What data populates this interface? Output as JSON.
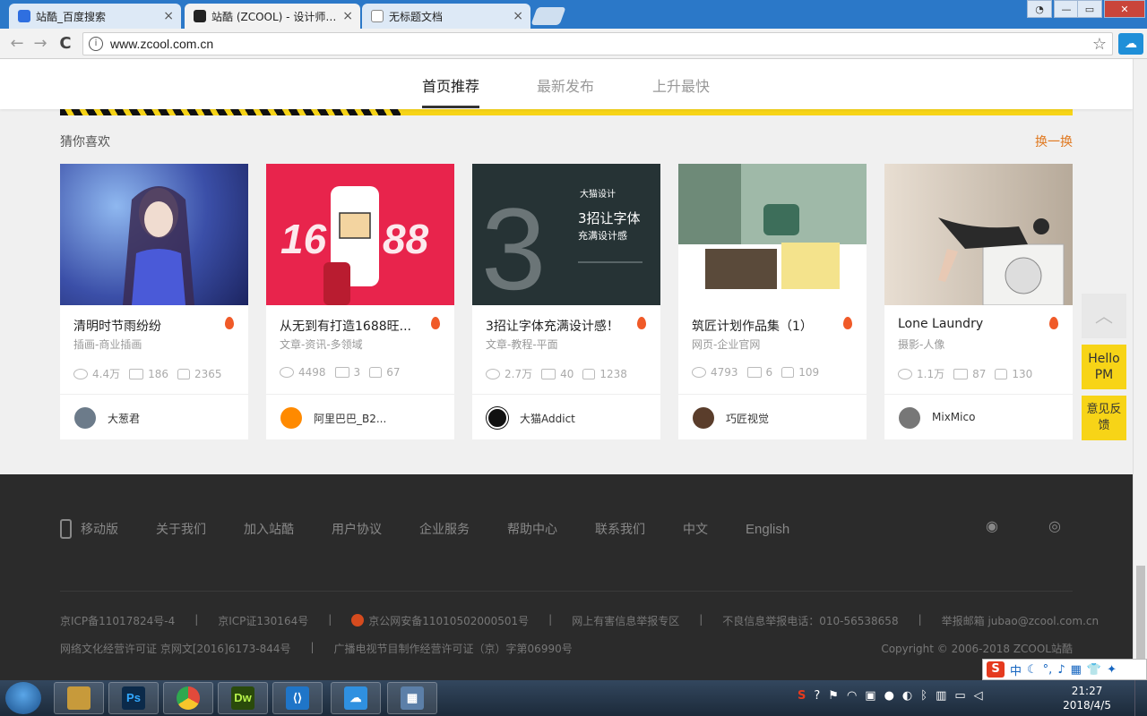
{
  "browser": {
    "tabs": [
      {
        "label": "站酷_百度搜索",
        "active": false,
        "favicon_color": "#2f6fe0"
      },
      {
        "label": "站酷 (ZCOOL) - 设计师互动平台",
        "active": true,
        "favicon_color": "#222222"
      },
      {
        "label": "无标题文档",
        "active": false,
        "favicon_color": "#888888"
      }
    ],
    "url": "www.zcool.com.cn",
    "close_label": "×",
    "back_icon": "←",
    "forward_icon": "→",
    "reload_icon": "C",
    "star_icon": "☆",
    "info_icon": "i"
  },
  "subnav": {
    "items": [
      "首页推荐",
      "最新发布",
      "上升最快"
    ],
    "active_index": 0
  },
  "section": {
    "title": "猜你喜欢",
    "refresh_label": "换一换"
  },
  "cards": [
    {
      "title": "清明时节雨纷纷",
      "category": "插画-商业插画",
      "views": "4.4万",
      "comments": "186",
      "likes": "2365",
      "author": "大葱君",
      "thumb_bg": "#3b4fa8",
      "avatar_bg": "#6c7b8a"
    },
    {
      "title": "从无到有打造1688旺...",
      "category": "文章-资讯-多领域",
      "views": "4498",
      "comments": "3",
      "likes": "67",
      "author": "阿里巴巴_B2...",
      "thumb_bg": "#e8244c",
      "avatar_bg": "#ff8a00",
      "thumb_text": "16 88"
    },
    {
      "title": "3招让字体充满设计感！",
      "category": "文章-教程-平面",
      "views": "2.7万",
      "comments": "40",
      "likes": "1238",
      "author": "大猫Addict",
      "thumb_bg": "#263335",
      "avatar_bg": "#111111",
      "thumb_text": "3招让字体",
      "thumb_sub": "充满设计感",
      "thumb_brand": "大猫设计"
    },
    {
      "title": "筑匠计划作品集（1）",
      "category": "网页-企业官网",
      "views": "4793",
      "comments": "6",
      "likes": "109",
      "author": "巧匠视觉",
      "thumb_bg": "#d9dcd6",
      "avatar_bg": "#5a3d2b"
    },
    {
      "title": "Lone Laundry",
      "category": "摄影-人像",
      "views": "1.1万",
      "comments": "87",
      "likes": "130",
      "author": "MixMico",
      "thumb_bg": "#cbbfb0",
      "avatar_bg": "#777777"
    }
  ],
  "floating": {
    "top_icon": "︿",
    "hello": "Hello PM",
    "feedback": "意见反馈"
  },
  "footer": {
    "links": [
      "移动版",
      "关于我们",
      "加入站酷",
      "用户协议",
      "企业服务",
      "帮助中心",
      "联系我们",
      "中文",
      "English"
    ],
    "row1": [
      "京ICP备11017824号-4",
      "京ICP证130164号",
      "京公网安备11010502000501号",
      "网上有害信息举报专区",
      "不良信息举报电话：010-56538658",
      "举报邮箱 jubao@zcool.com.cn"
    ],
    "row2": [
      "网络文化经营许可证 京网文[2016]6173-844号",
      "广播电视节目制作经营许可证（京）字第06990号"
    ],
    "copyright": "Copyright © 2006-2018 ZCOOL站酷"
  },
  "ime": {
    "label": "中"
  },
  "taskbar": {
    "apps": [
      {
        "name": "file-explorer",
        "label": "",
        "color": "#c79a3b"
      },
      {
        "name": "photoshop",
        "label": "Ps",
        "color": "#0b2a4a"
      },
      {
        "name": "chrome",
        "label": "",
        "color": "#e24a3b"
      },
      {
        "name": "dreamweaver",
        "label": "Dw",
        "color": "#2a4a0b"
      },
      {
        "name": "vscode",
        "label": "",
        "color": "#1f75c8"
      },
      {
        "name": "baidu-netdisk",
        "label": "",
        "color": "#2f90e0"
      },
      {
        "name": "calculator",
        "label": "",
        "color": "#5c7fa8"
      }
    ],
    "time": "21:27",
    "date": "2018/4/5"
  }
}
